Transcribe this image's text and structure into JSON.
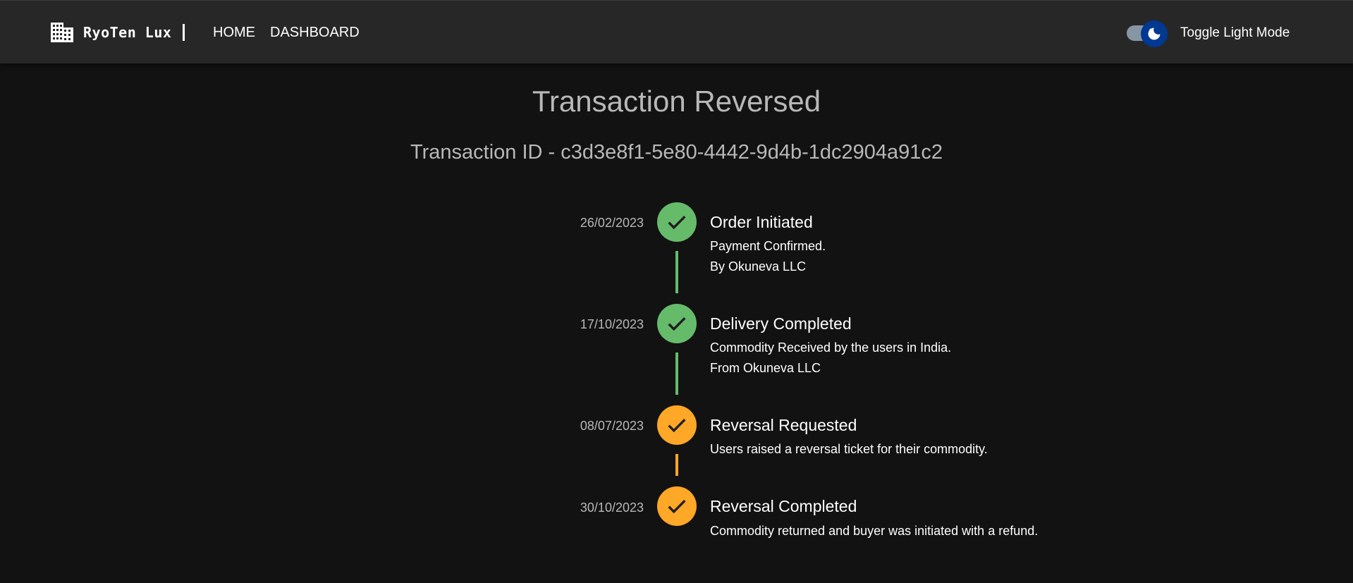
{
  "brand": {
    "name": "RyoTen Lux",
    "icon": "building-icon"
  },
  "nav": {
    "home": "HOME",
    "dashboard": "DASHBOARD"
  },
  "theme_toggle": {
    "label": "Toggle Light Mode",
    "icon": "moon-icon",
    "checked": true
  },
  "page": {
    "title": "Transaction Reversed",
    "txn_prefix": "Transaction ID - ",
    "txn_id": "c3d3e8f1-5e80-4442-9d4b-1dc2904a91c2"
  },
  "colors": {
    "success": "#66bb6a",
    "warning": "#ffa726",
    "toggle_thumb": "#003892",
    "toggle_track": "#8796a5"
  },
  "timeline": [
    {
      "date": "26/02/2023",
      "title": "Order Initiated",
      "lines": [
        "Payment Confirmed.",
        "By Okuneva LLC"
      ],
      "status": "success",
      "icon": "check-icon"
    },
    {
      "date": "17/10/2023",
      "title": "Delivery Completed",
      "lines": [
        "Commodity Received by the users in India.",
        "From Okuneva LLC"
      ],
      "status": "success",
      "icon": "check-icon"
    },
    {
      "date": "08/07/2023",
      "title": "Reversal Requested",
      "lines": [
        "Users raised a reversal ticket for their commodity."
      ],
      "status": "warning",
      "icon": "check-icon"
    },
    {
      "date": "30/10/2023",
      "title": "Reversal Completed",
      "lines": [
        "Commodity returned and buyer was initiated with a refund."
      ],
      "status": "warning",
      "icon": "check-icon"
    }
  ]
}
